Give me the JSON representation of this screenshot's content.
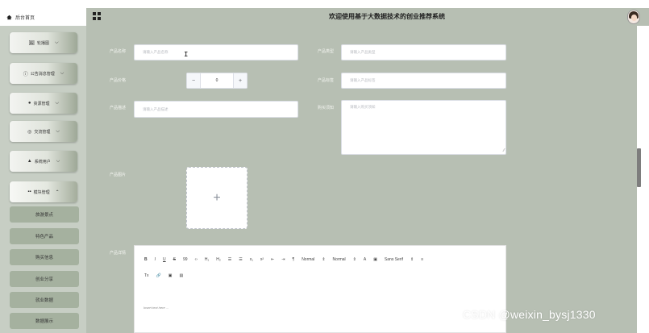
{
  "header": {
    "home_tab": "后台首页",
    "title": "欢迎使用基于大数据技术的创业推荐系统"
  },
  "sidebar": {
    "items": [
      {
        "label": "轮播图",
        "icon": "image-icon"
      },
      {
        "label": "公告消息管理",
        "icon": "info-icon"
      },
      {
        "label": "资源管理",
        "icon": "pin-icon"
      },
      {
        "label": "交流管理",
        "icon": "chat-icon"
      },
      {
        "label": "系统用户",
        "icon": "user-icon"
      },
      {
        "label": "模块管理",
        "icon": "grid-icon"
      }
    ],
    "sub_items": [
      "旅游景点",
      "特色产品",
      "购买信息",
      "创业分享",
      "就业数据",
      "数据展示"
    ]
  },
  "form": {
    "name_label": "产品名称",
    "name_placeholder": "请输入产品名称",
    "type_label": "产品类型",
    "type_placeholder": "请输入产品类型",
    "price_label": "产品价格",
    "price_value": "0",
    "tag_label": "产品标签",
    "tag_placeholder": "请输入产品标签",
    "desc_label": "产品描述",
    "desc_placeholder": "请输入产品描述",
    "buy_label": "购买须知",
    "buy_placeholder": "请输入购买须知",
    "image_label": "产品图片",
    "detail_label": "产品详情"
  },
  "editor": {
    "tools_row1": [
      "B",
      "I",
      "U",
      "S",
      "99",
      "‹›",
      "H₁",
      "H₂",
      "☰",
      "☰",
      "x₁",
      "x²",
      "⇤",
      "⇥",
      "¶",
      "Normal",
      "⇕",
      "Normal",
      "⇕",
      "A",
      "▣",
      "Sans Serif",
      "⇕",
      "≡"
    ],
    "tools_row2": [
      "Tx",
      "🔗",
      "▣",
      "▤"
    ],
    "placeholder": "Insert text here ..."
  },
  "watermark": "CSDN @weixin_bysj1330"
}
